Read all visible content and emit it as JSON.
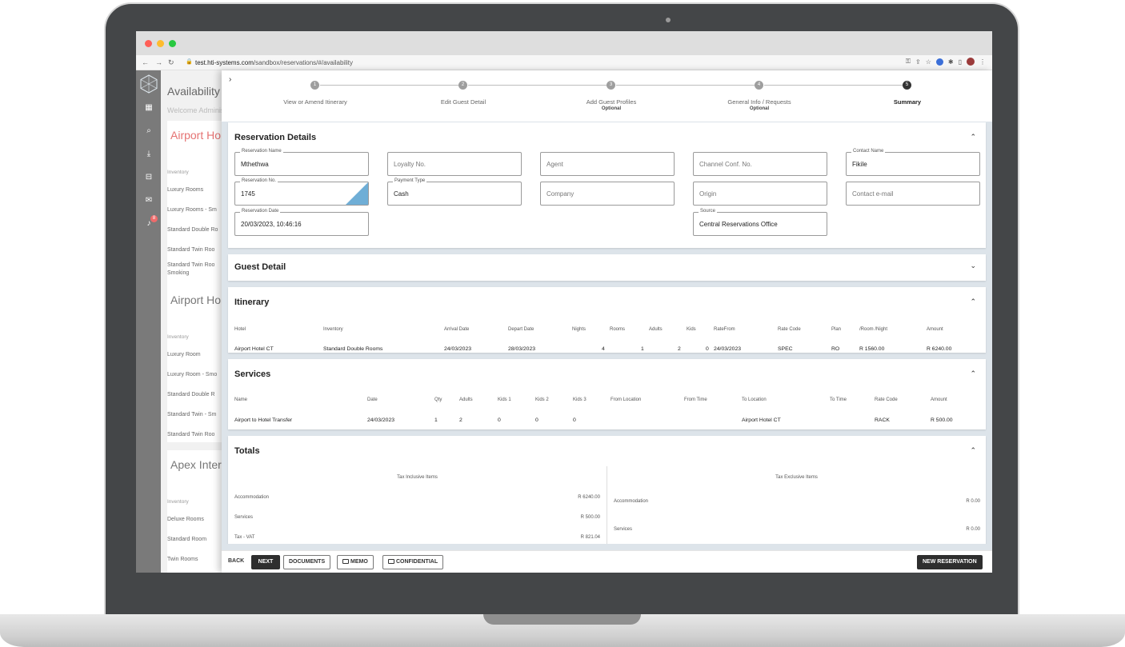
{
  "browser": {
    "url_host": "test.hti-systems.com",
    "url_path": "/sandbox/reservations/#/availability"
  },
  "background": {
    "title": "Availability",
    "welcome": "Welcome Adminis",
    "notification_count": "8",
    "hotels": [
      {
        "name": "Airport Ho",
        "inventory_label": "Inventory",
        "items": [
          "Luxury Rooms",
          "Luxury Rooms - Sm",
          "Standard Double Ro",
          "Standard Twin Roo",
          "Standard Twin Roo Smoking"
        ]
      },
      {
        "name": "Airport Ho",
        "inventory_label": "Inventory",
        "items": [
          "Luxury Room",
          "Luxury Room - Smo",
          "Standard Double R",
          "Standard Twin - Sm",
          "Standard Twin Roo"
        ]
      },
      {
        "name": "Apex Inter",
        "inventory_label": "Inventory",
        "items": [
          "Deluxe Rooms",
          "Standard Room",
          "Twin Rooms"
        ]
      }
    ]
  },
  "stepper": {
    "steps": [
      {
        "num": "1",
        "label": "View or Amend Itinerary",
        "sub": ""
      },
      {
        "num": "2",
        "label": "Edit Guest Detail",
        "sub": ""
      },
      {
        "num": "3",
        "label": "Add Guest Profiles",
        "sub": "Optional"
      },
      {
        "num": "4",
        "label": "General Info / Requests",
        "sub": "Optional"
      },
      {
        "num": "5",
        "label": "Summary",
        "sub": ""
      }
    ]
  },
  "reservation": {
    "title": "Reservation Details",
    "name_label": "Reservation Name",
    "name_value": "Mthethwa",
    "loyalty_placeholder": "Loyalty No.",
    "agent_placeholder": "Agent",
    "channel_placeholder": "Channel Conf. No.",
    "contact_label": "Contact Name",
    "contact_value": "Fikile",
    "resno_label": "Reservation No.",
    "resno_value": "1745",
    "payment_label": "Payment Type",
    "payment_value": "Cash",
    "company_placeholder": "Company",
    "origin_placeholder": "Origin",
    "email_placeholder": "Contact e-mail",
    "date_label": "Reservation Date",
    "date_value": "20/03/2023, 10:46:16",
    "source_label": "Source",
    "source_value": "Central Reservations Office"
  },
  "guest_detail": {
    "title": "Guest Detail"
  },
  "itinerary": {
    "title": "Itinerary",
    "headers": [
      "Hotel",
      "Inventory",
      "Arrival Date",
      "Depart Date",
      "Nights",
      "Rooms",
      "Adults",
      "Kids",
      "RateFrom",
      "Rate Code",
      "Plan",
      "/Room /Night",
      "Amount"
    ],
    "row": [
      "Airport Hotel CT",
      "Standard Double Rooms",
      "24/03/2023",
      "28/03/2023",
      "4",
      "1",
      "2",
      "0",
      "24/03/2023",
      "SPEC",
      "RO",
      "R 1560.00",
      "R 6240.00"
    ]
  },
  "services": {
    "title": "Services",
    "headers": [
      "Name",
      "Date",
      "Qty",
      "Adults",
      "Kids 1",
      "Kids 2",
      "Kids 3",
      "From Location",
      "From Time",
      "To Location",
      "To Time",
      "Rate Code",
      "Amount"
    ],
    "row": [
      "Airport to Hotel Transfer",
      "24/03/2023",
      "1",
      "2",
      "0",
      "0",
      "0",
      "",
      "",
      "Airport Hotel CT",
      "",
      "RACK",
      "R 500.00"
    ]
  },
  "totals": {
    "title": "Totals",
    "inclusive_title": "Tax Inclusive Items",
    "exclusive_title": "Tax Exclusive Items",
    "inclusive": [
      {
        "label": "Accommodation",
        "value": "R 6240.00"
      },
      {
        "label": "Services",
        "value": "R 500.00"
      },
      {
        "label": "Tax - VAT",
        "value": "R 821.04"
      }
    ],
    "exclusive": [
      {
        "label": "Accommodation",
        "value": "R 0.00"
      },
      {
        "label": "Services",
        "value": "R 0.00"
      }
    ]
  },
  "footer": {
    "back": "BACK",
    "next": "NEXT",
    "documents": "DOCUMENTS",
    "memo": "MEMO",
    "confidential": "CONFIDENTIAL",
    "new_reservation": "NEW RESERVATION"
  }
}
